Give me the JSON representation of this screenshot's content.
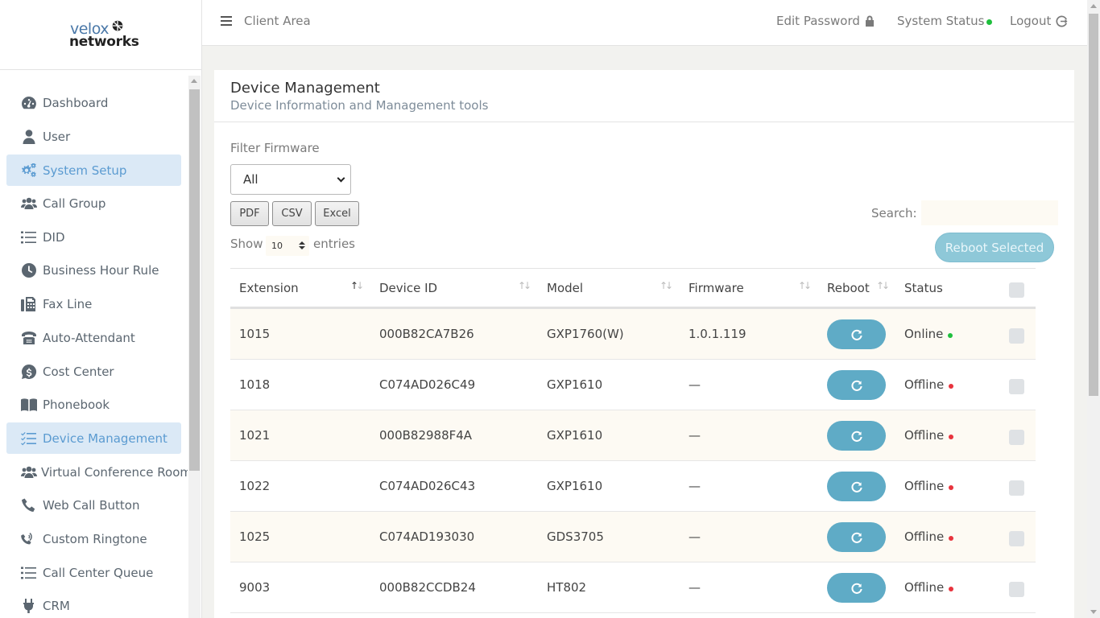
{
  "brand": {
    "line1": "velox",
    "line2": "networks"
  },
  "sidebar": {
    "items": [
      {
        "label": "Dashboard",
        "icon": "dashboard-icon",
        "active": false
      },
      {
        "label": "User",
        "icon": "user-icon",
        "active": false
      },
      {
        "label": "System Setup",
        "icon": "gears-icon",
        "active": true
      },
      {
        "label": "Call Group",
        "icon": "users-icon",
        "active": false
      },
      {
        "label": "DID",
        "icon": "list-icon",
        "active": false
      },
      {
        "label": "Business Hour Rule",
        "icon": "clock-icon",
        "active": false
      },
      {
        "label": "Fax Line",
        "icon": "fax-icon",
        "active": false
      },
      {
        "label": "Auto-Attendant",
        "icon": "phone-office-icon",
        "active": false
      },
      {
        "label": "Cost Center",
        "icon": "dollar-icon",
        "active": false
      },
      {
        "label": "Phonebook",
        "icon": "book-icon",
        "active": false
      },
      {
        "label": "Device Management",
        "icon": "tasks-icon",
        "active": true
      },
      {
        "label": "Virtual Conference Room",
        "icon": "users-icon",
        "active": false
      },
      {
        "label": "Web Call Button",
        "icon": "phone-icon",
        "active": false
      },
      {
        "label": "Custom Ringtone",
        "icon": "ringtone-icon",
        "active": false
      },
      {
        "label": "Call Center Queue",
        "icon": "list-icon",
        "active": false
      },
      {
        "label": "CRM",
        "icon": "plug-icon",
        "active": false
      }
    ]
  },
  "topbar": {
    "breadcrumb": "Client Area",
    "edit_password": "Edit Password",
    "system_status": "System Status",
    "logout": "Logout"
  },
  "page": {
    "title": "Device Management",
    "subtitle": "Device Information and Management tools"
  },
  "filter": {
    "label": "Filter Firmware",
    "selected": "All"
  },
  "export_buttons": [
    "PDF",
    "CSV",
    "Excel"
  ],
  "length": {
    "show": "Show",
    "value": "10",
    "entries": "entries"
  },
  "search": {
    "label": "Search:",
    "value": ""
  },
  "reboot_selected": "Reboot Selected",
  "table": {
    "columns": [
      "Extension",
      "Device ID",
      "Model",
      "Firmware",
      "Reboot",
      "Status"
    ],
    "rows": [
      {
        "extension": "1015",
        "device_id": "000B82CA7B26",
        "model": "GXP1760(W)",
        "firmware": "1.0.1.119",
        "status": "Online"
      },
      {
        "extension": "1018",
        "device_id": "C074AD026C49",
        "model": "GXP1610",
        "firmware": "—",
        "status": "Offline"
      },
      {
        "extension": "1021",
        "device_id": "000B82988F4A",
        "model": "GXP1610",
        "firmware": "—",
        "status": "Offline"
      },
      {
        "extension": "1022",
        "device_id": "C074AD026C43",
        "model": "GXP1610",
        "firmware": "—",
        "status": "Offline"
      },
      {
        "extension": "1025",
        "device_id": "C074AD193030",
        "model": "GDS3705",
        "firmware": "—",
        "status": "Offline"
      },
      {
        "extension": "9003",
        "device_id": "000B82CCDB24",
        "model": "HT802",
        "firmware": "—",
        "status": "Offline"
      }
    ]
  },
  "colors": {
    "accent": "#5fabc6",
    "active_nav_bg": "#dbe9f6",
    "active_nav_text": "#5b9bd1",
    "online": "#1fbf3d",
    "offline": "#e8333d"
  }
}
